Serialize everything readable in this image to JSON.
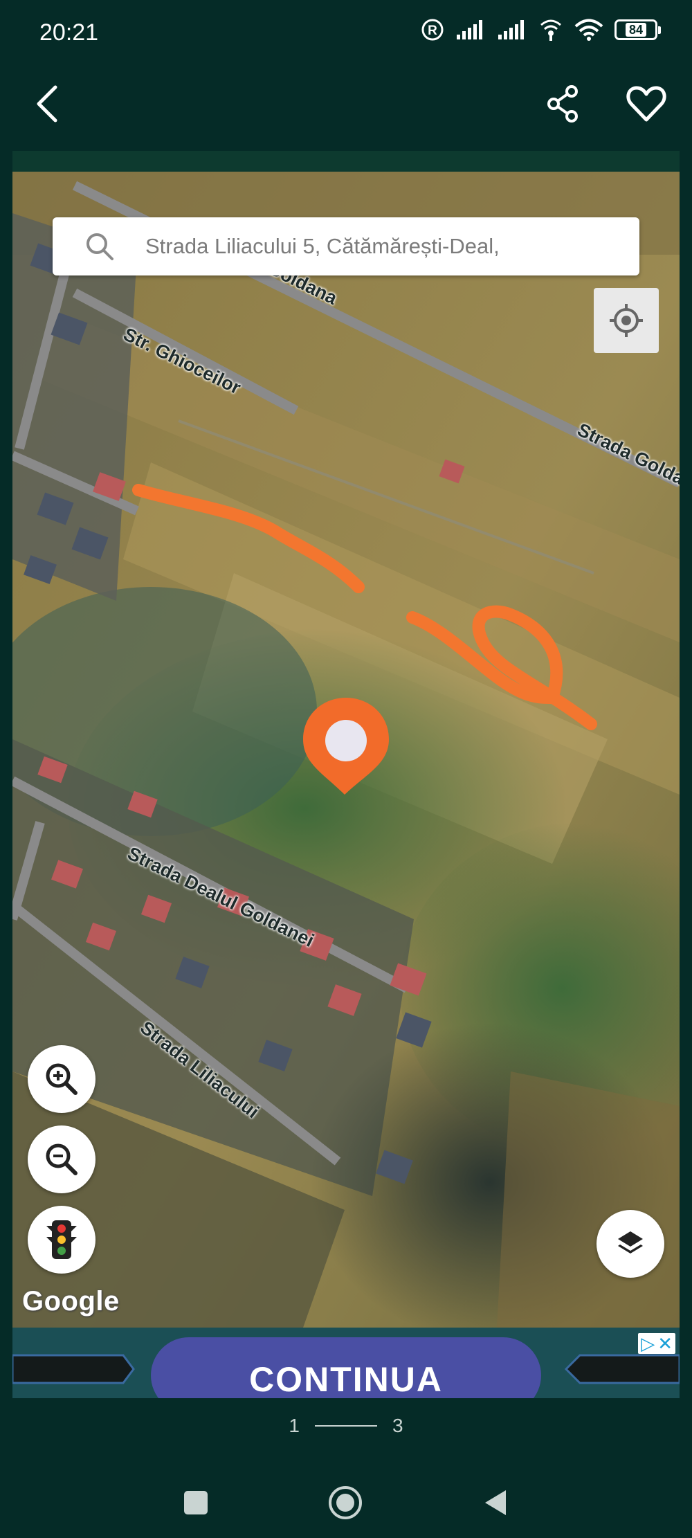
{
  "status_bar": {
    "time": "20:21",
    "battery_level": "84",
    "icons": [
      "registered-icon",
      "signal-icon",
      "signal-icon",
      "hotspot-icon",
      "wifi-icon",
      "battery-icon"
    ]
  },
  "app_bar": {
    "icons": [
      "back-arrow-icon",
      "share-icon",
      "heart-icon"
    ]
  },
  "map": {
    "search": {
      "placeholder": "Strada Liliacului 5, Cătămărești-Deal,"
    },
    "street_labels": {
      "goldana_top": "Goldana",
      "ghioceilor": "Str. Ghioceilor",
      "goldana_right": "Strada Goldana",
      "dealul_goldanei": "Strada Dealul Goldanei",
      "liliacului": "Strada Liliacului"
    },
    "attribution": "Google",
    "controls": [
      "my-location-icon",
      "zoom-in-icon",
      "zoom-out-icon",
      "traffic-light-icon",
      "layers-icon"
    ],
    "marker_color": "#f26b2a",
    "annotation_color": "#f3762f"
  },
  "ad": {
    "button_label": "CONTINUA",
    "badges": [
      "▷",
      "✕"
    ],
    "button_color": "#4a4fa4"
  },
  "pager": {
    "current": "1",
    "total": "3"
  },
  "nav_bar": {
    "icons": [
      "recent-apps-icon",
      "home-icon",
      "back-icon"
    ]
  },
  "colors": {
    "background": "#052b27",
    "accent": "#ffffff"
  }
}
